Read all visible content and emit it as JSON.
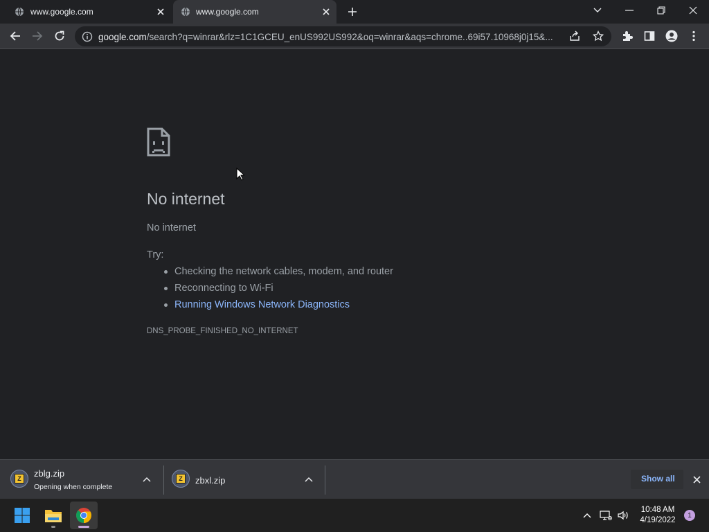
{
  "browser": {
    "tabs": [
      {
        "title": "www.google.com",
        "active": false
      },
      {
        "title": "www.google.com",
        "active": true
      }
    ],
    "address_bar": {
      "host": "google.com",
      "path": "/search?q=winrar&rlz=1C1GCEU_enUS992US992&oq=winrar&aqs=chrome..69i57.10968j0j15&..."
    }
  },
  "error_page": {
    "title": "No internet",
    "subtitle": "No internet",
    "try_label": "Try:",
    "suggestions": [
      "Checking the network cables, modem, and router",
      "Reconnecting to Wi-Fi",
      "Running Windows Network Diagnostics"
    ],
    "error_code": "DNS_PROBE_FINISHED_NO_INTERNET"
  },
  "downloads": {
    "items": [
      {
        "filename": "zblg.zip",
        "status": "Opening when complete"
      },
      {
        "filename": "zbxl.zip",
        "status": ""
      }
    ],
    "show_all_label": "Show all"
  },
  "taskbar": {
    "time": "10:48 AM",
    "date": "4/19/2022",
    "notification_count": "1"
  },
  "colors": {
    "page_bg": "#202124",
    "toolbar_bg": "#35363a",
    "link": "#8ab4f8",
    "taskbar_bg": "#202020"
  },
  "icons": [
    "globe-icon",
    "close-icon",
    "plus-icon",
    "chevron-down-icon",
    "minimize-icon",
    "restore-icon",
    "back-icon",
    "forward-icon",
    "reload-icon",
    "info-icon",
    "share-icon",
    "star-icon",
    "puzzle-icon",
    "side-panel-icon",
    "profile-icon",
    "kebab-menu-icon",
    "sad-page-icon",
    "winrar-icon",
    "chevron-up-icon",
    "windows-start-icon",
    "file-explorer-icon",
    "chrome-icon",
    "network-icon",
    "volume-icon"
  ]
}
